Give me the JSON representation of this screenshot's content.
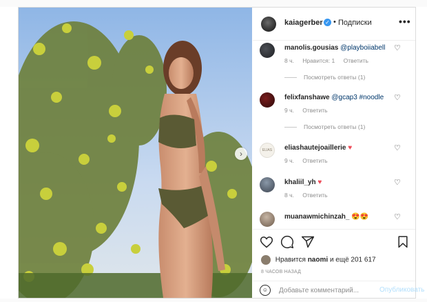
{
  "header": {
    "username": "kaiagerber",
    "verified_mark": "✓",
    "separator": "•",
    "follow_label": "Подписки",
    "more_label": "•••"
  },
  "comments": [
    {
      "user": "manolis.gousias",
      "text": "",
      "mention": "@playboiiabell",
      "emoji": "",
      "time": "8 ч.",
      "likes": "Нравится: 1",
      "reply": "Ответить",
      "view_replies": "Посмотреть ответы (1)"
    },
    {
      "user": "felixfanshawe",
      "text": "",
      "mention": "@gcap3 #noodle",
      "emoji": "",
      "time": "9 ч.",
      "likes": "",
      "reply": "Ответить",
      "view_replies": "Посмотреть ответы (1)"
    },
    {
      "user": "eliashautejoaillerie",
      "text": "",
      "mention": "",
      "emoji": "♥",
      "time": "9 ч.",
      "likes": "",
      "reply": "Ответить",
      "view_replies": ""
    },
    {
      "user": "khaliil_yh",
      "text": "",
      "mention": "",
      "emoji": "♥",
      "time": "8 ч.",
      "likes": "",
      "reply": "Ответить",
      "view_replies": ""
    },
    {
      "user": "muanawmichinzah_",
      "text": "",
      "mention": "",
      "emoji": "😍😍",
      "time": "",
      "likes": "",
      "reply": "",
      "view_replies": ""
    }
  ],
  "actions": {
    "icons": [
      "heart-icon",
      "comment-icon",
      "share-icon",
      "bookmark-icon"
    ],
    "likes_prefix": "Нравится",
    "likes_user": "naomi",
    "likes_suffix": "и ещё 201 617",
    "time_ago": "8 ЧАСОВ НАЗАД"
  },
  "add_comment": {
    "placeholder": "Добавьте комментарий...",
    "post_label": "Опубликовать"
  },
  "carousel": {
    "next_label": "›"
  },
  "colors": {
    "accent": "#3897f0",
    "emoji_heart": "#ed4956",
    "post_disabled": "#b2dffc",
    "secondary_text": "#8e8e8e"
  }
}
